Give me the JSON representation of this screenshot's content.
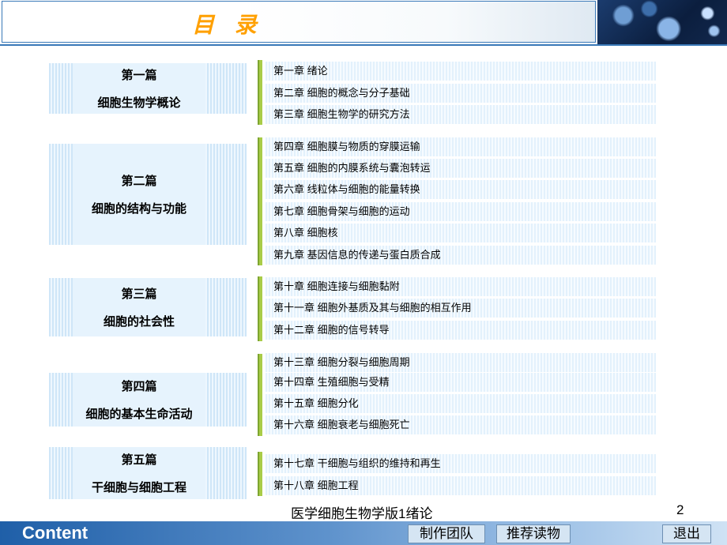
{
  "header": {
    "title": "目 录"
  },
  "parts": [
    {
      "title": "第一篇",
      "subtitle": "细胞生物学概论",
      "chapters": [
        "第一章 绪论",
        "第二章 细胞的概念与分子基础",
        "第三章 细胞生物学的研究方法"
      ]
    },
    {
      "title": "第二篇",
      "subtitle": "细胞的结构与功能",
      "chapters": [
        "第四章 细胞膜与物质的穿膜运输",
        "第五章 细胞的内膜系统与囊泡转运",
        "第六章 线粒体与细胞的能量转换",
        "第七章 细胞骨架与细胞的运动",
        "第八章 细胞核",
        "第九章 基因信息的传递与蛋白质合成"
      ]
    },
    {
      "title": "第三篇",
      "subtitle": "细胞的社会性",
      "chapters": [
        "第十章 细胞连接与细胞黏附",
        "第十一章 细胞外基质及其与细胞的相互作用",
        "第十二章 细胞的信号转导"
      ]
    },
    {
      "title": "第四篇",
      "subtitle": "细胞的基本生命活动",
      "chapters": [
        "第十三章 细胞分裂与细胞周期",
        "第十四章 生殖细胞与受精",
        "第十五章 细胞分化",
        "第十六章 细胞衰老与细胞死亡"
      ]
    },
    {
      "title": "第五篇",
      "subtitle": "干细胞与细胞工程",
      "chapters": [
        "第十七章 干细胞与组织的维持和再生",
        "第十八章 细胞工程"
      ]
    }
  ],
  "footer": {
    "caption": "医学细胞生物学版1绪论",
    "page_number": "2",
    "content_label": "Content",
    "nav": {
      "team": "制作团队",
      "reading": "推荐读物",
      "exit": "退出"
    }
  },
  "colors": {
    "title": "#ffa000",
    "accent_blue": "#3a79b8",
    "bracket_green": "#a9cc48"
  }
}
